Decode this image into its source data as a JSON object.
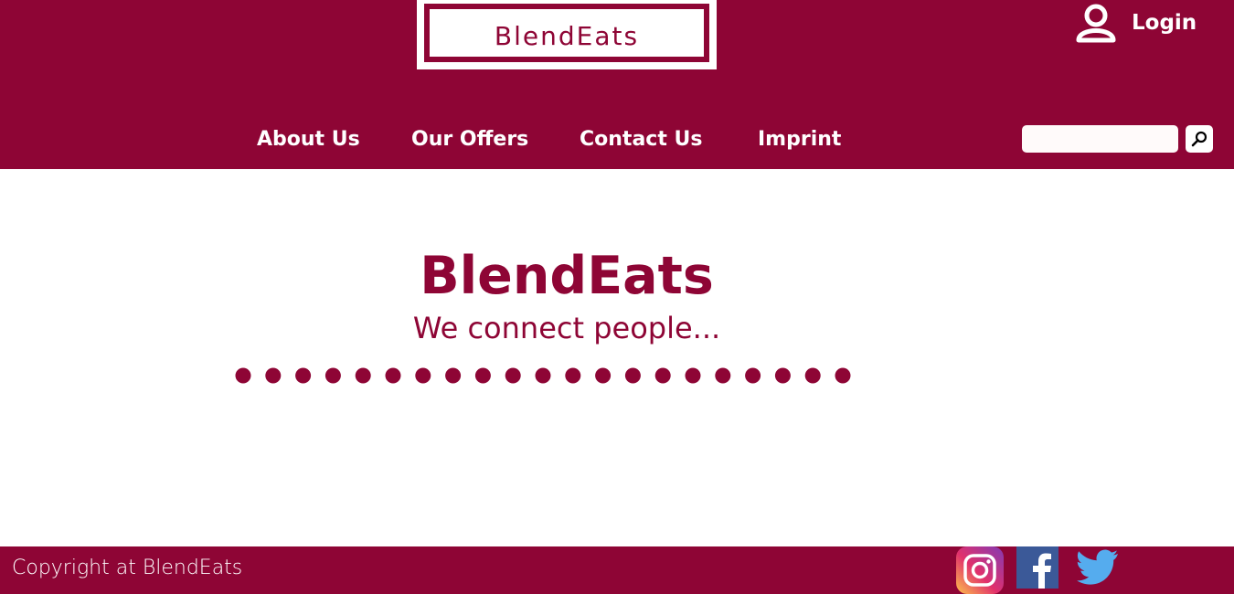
{
  "header": {
    "logo_text": "BlendEats",
    "login_label": "Login",
    "nav": [
      {
        "label": "About Us"
      },
      {
        "label": "Our Offers"
      },
      {
        "label": "Contact Us"
      },
      {
        "label": "Imprint"
      }
    ],
    "search": {
      "placeholder": "",
      "value": ""
    }
  },
  "hero": {
    "title": "BlendEats",
    "subtitle": "We connect people...",
    "dot_count": 21
  },
  "footer": {
    "copyright": "Copyright at BlendEats",
    "social": [
      "instagram-icon",
      "facebook-icon",
      "twitter-icon"
    ]
  },
  "colors": {
    "brand": "#8e0535",
    "background": "#ffffff",
    "facebook": "#3b5998",
    "twitter": "#55acee"
  }
}
